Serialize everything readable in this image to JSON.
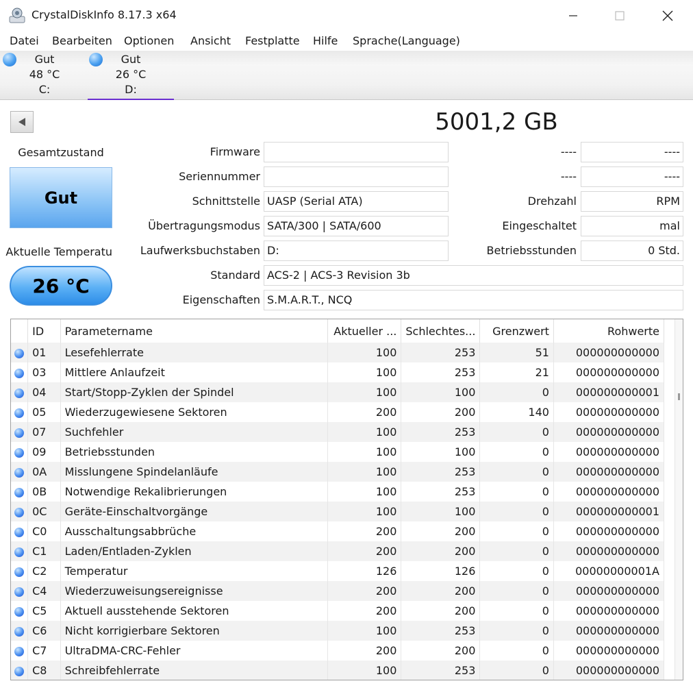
{
  "window": {
    "title": "CrystalDiskInfo 8.17.3 x64"
  },
  "menu": [
    "Datei",
    "Bearbeiten",
    "Optionen",
    "Ansicht",
    "Festplatte",
    "Hilfe",
    "Sprache(Language)"
  ],
  "drives": [
    {
      "status": "Gut",
      "temp": "48 °C",
      "letter": "C:"
    },
    {
      "status": "Gut",
      "temp": "26 °C",
      "letter": "D:"
    }
  ],
  "disk": {
    "size": "5001,2 GB",
    "health_label": "Gesamtzustand",
    "health": "Gut",
    "temp_label": "Aktuelle Temperatu",
    "temp": "26 °C"
  },
  "fields": {
    "firmware": {
      "label": "Firmware",
      "value": ""
    },
    "serial": {
      "label": "Seriennummer",
      "value": ""
    },
    "interface": {
      "label": "Schnittstelle",
      "value": "UASP (Serial ATA)"
    },
    "transfer": {
      "label": "Übertragungsmodus",
      "value": "SATA/300 | SATA/600"
    },
    "letters": {
      "label": "Laufwerksbuchstaben",
      "value": "D:"
    },
    "standard": {
      "label": "Standard",
      "value": "ACS-2 | ACS-3 Revision 3b"
    },
    "features": {
      "label": "Eigenschaften",
      "value": "S.M.A.R.T., NCQ"
    },
    "r1": {
      "label": "----",
      "value": "----"
    },
    "r2": {
      "label": "----",
      "value": "----"
    },
    "rpm": {
      "label": "Drehzahl",
      "value": "RPM"
    },
    "power_count": {
      "label": "Eingeschaltet",
      "value": "mal"
    },
    "hours": {
      "label": "Betriebsstunden",
      "value": "0 Std."
    }
  },
  "table": {
    "headers": [
      "ID",
      "Parametername",
      "Aktueller ...",
      "Schlechtes...",
      "Grenzwert",
      "Rohwerte"
    ],
    "rows": [
      [
        "01",
        "Lesefehlerrate",
        "100",
        "253",
        "51",
        "000000000000"
      ],
      [
        "03",
        "Mittlere Anlaufzeit",
        "100",
        "253",
        "21",
        "000000000000"
      ],
      [
        "04",
        "Start/Stopp-Zyklen der Spindel",
        "100",
        "100",
        "0",
        "000000000001"
      ],
      [
        "05",
        "Wiederzugewiesene Sektoren",
        "200",
        "200",
        "140",
        "000000000000"
      ],
      [
        "07",
        "Suchfehler",
        "100",
        "253",
        "0",
        "000000000000"
      ],
      [
        "09",
        "Betriebsstunden",
        "100",
        "100",
        "0",
        "000000000000"
      ],
      [
        "0A",
        "Misslungene Spindelanläufe",
        "100",
        "253",
        "0",
        "000000000000"
      ],
      [
        "0B",
        "Notwendige Rekalibrierungen",
        "100",
        "253",
        "0",
        "000000000000"
      ],
      [
        "0C",
        "Geräte-Einschaltvorgänge",
        "100",
        "100",
        "0",
        "000000000001"
      ],
      [
        "C0",
        "Ausschaltungsabbrüche",
        "200",
        "200",
        "0",
        "000000000000"
      ],
      [
        "C1",
        "Laden/Entladen-Zyklen",
        "200",
        "200",
        "0",
        "000000000000"
      ],
      [
        "C2",
        "Temperatur",
        "126",
        "126",
        "0",
        "00000000001A"
      ],
      [
        "C4",
        "Wiederzuweisungsereignisse",
        "200",
        "200",
        "0",
        "000000000000"
      ],
      [
        "C5",
        "Aktuell ausstehende Sektoren",
        "200",
        "200",
        "0",
        "000000000000"
      ],
      [
        "C6",
        "Nicht korrigierbare Sektoren",
        "100",
        "253",
        "0",
        "000000000000"
      ],
      [
        "C7",
        "UltraDMA-CRC-Fehler",
        "200",
        "200",
        "0",
        "000000000000"
      ],
      [
        "C8",
        "Schreibfehlerrate",
        "100",
        "253",
        "0",
        "000000000000"
      ]
    ]
  },
  "colors": {
    "accent": "#6a2ed0",
    "health_blue": "#5aa5ee",
    "status_dot": "#4a8ff0"
  }
}
